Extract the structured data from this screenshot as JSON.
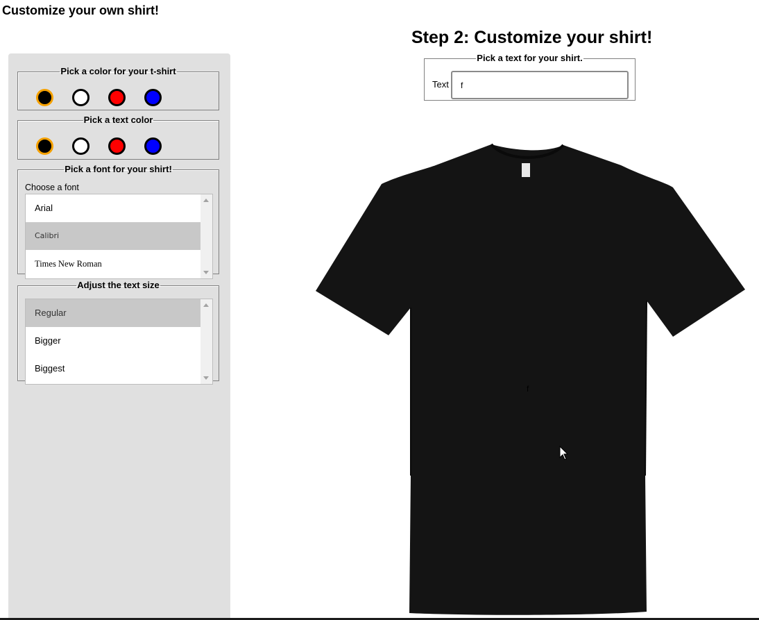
{
  "page": {
    "title": "Customize your own shirt!"
  },
  "sidebar": {
    "shirt_color": {
      "legend": "Pick a color for your t-shirt",
      "options": [
        {
          "name": "black",
          "color": "#000000",
          "selected": true
        },
        {
          "name": "white",
          "color": "#ffffff",
          "selected": false
        },
        {
          "name": "red",
          "color": "#ff0000",
          "selected": false
        },
        {
          "name": "blue",
          "color": "#0000ff",
          "selected": false
        }
      ]
    },
    "text_color": {
      "legend": "Pick a text color",
      "options": [
        {
          "name": "black",
          "color": "#000000",
          "selected": true
        },
        {
          "name": "white",
          "color": "#ffffff",
          "selected": false
        },
        {
          "name": "red",
          "color": "#ff0000",
          "selected": false
        },
        {
          "name": "blue",
          "color": "#0000ff",
          "selected": false
        }
      ]
    },
    "font": {
      "legend": "Pick a font for your shirt!",
      "label": "Choose a font",
      "options": [
        "Arial",
        "Calibri",
        "Times New Roman"
      ],
      "selected": "Calibri"
    },
    "size": {
      "legend": "Adjust the text size",
      "options": [
        "Regular",
        "Bigger",
        "Biggest"
      ],
      "selected": "Regular"
    }
  },
  "main": {
    "step_title": "Step 2: Customize your shirt!",
    "text_section": {
      "legend": "Pick a text for your shirt.",
      "label": "Text",
      "value": "f"
    },
    "shirt": {
      "color": "#141414",
      "text": "f"
    }
  },
  "colors": {
    "selected_ring": "#f5a100",
    "sidebar_bg": "#e0e0e0",
    "selected_item_bg": "#c8c8c8"
  }
}
